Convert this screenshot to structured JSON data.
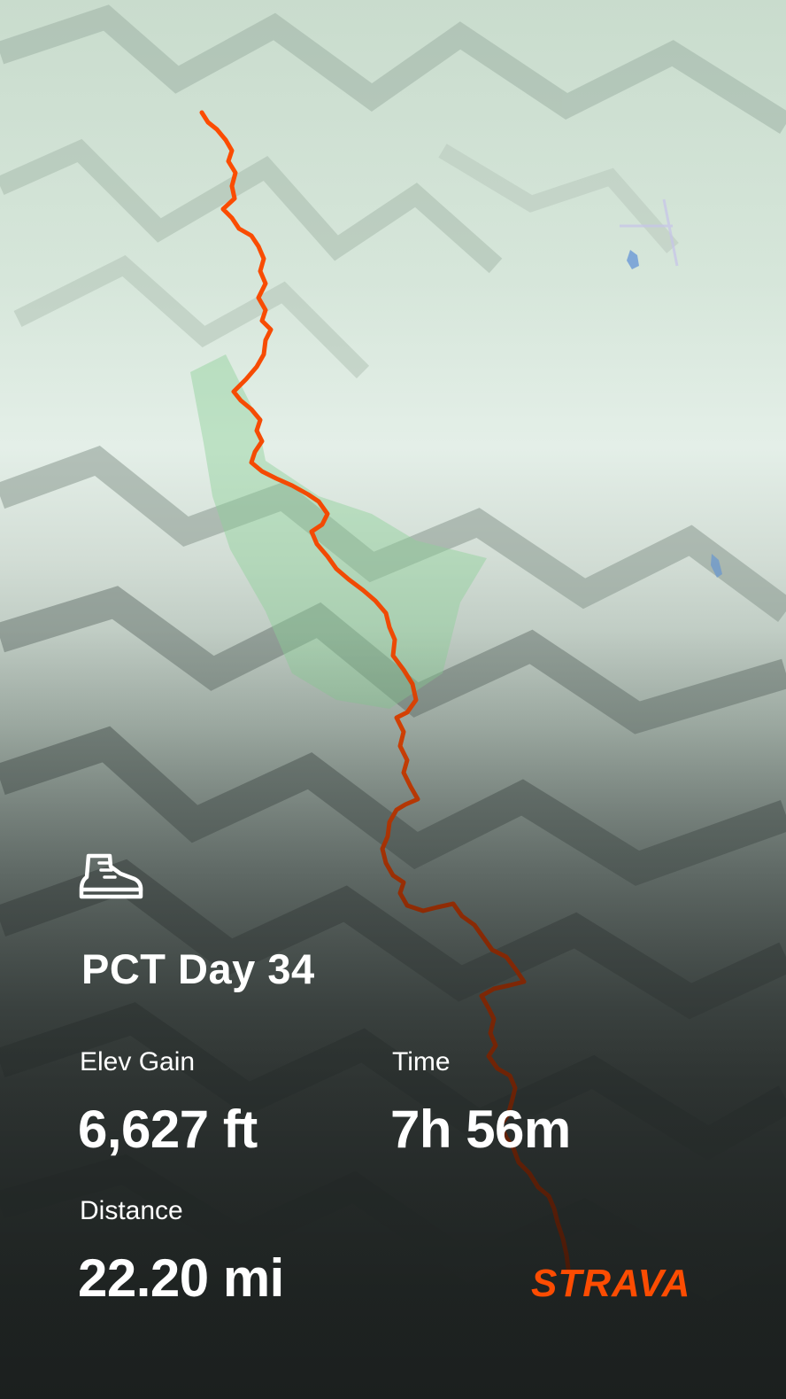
{
  "activity": {
    "icon": "hiking-boot-icon",
    "title": "PCT Day 34"
  },
  "stats": {
    "elev_gain": {
      "label": "Elev Gain",
      "value": "6,627 ft"
    },
    "time": {
      "label": "Time",
      "value": "7h 56m"
    },
    "distance": {
      "label": "Distance",
      "value": "22.20 mi"
    }
  },
  "brand": {
    "name": "STRAVA",
    "color": "#fc4c02"
  },
  "map": {
    "route_color": "#fc4c02",
    "forest_color": "#8fd19a",
    "water_color": "#5b8fd6"
  }
}
